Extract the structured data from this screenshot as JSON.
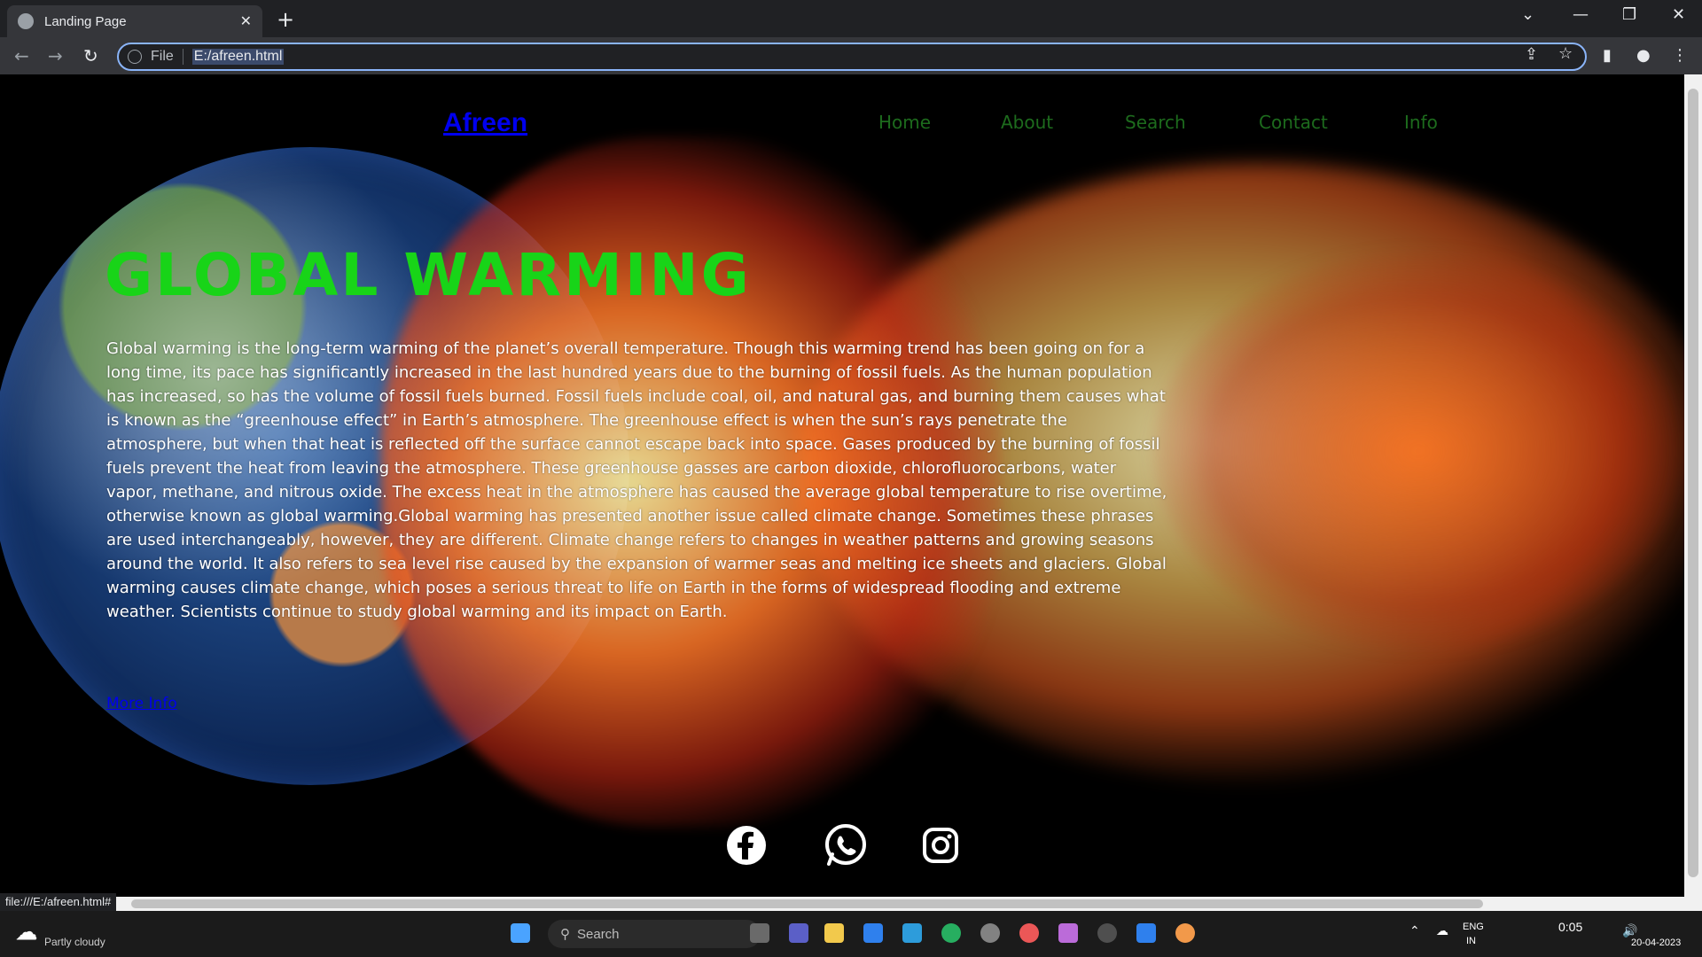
{
  "browser": {
    "tab_title": "Landing Page",
    "address_scheme": "File",
    "address_url": "E:/afreen.html",
    "status_url": "file:///E:/afreen.html#"
  },
  "site": {
    "brand": "Afreen",
    "nav": [
      "Home",
      "About",
      "Search",
      "Contact",
      "Info"
    ],
    "hero_title": "GLOBAL WARMING",
    "hero_text": "Global warming is the long-term warming of the planet’s overall temperature. Though this warming trend has been going on for a long time, its pace has significantly increased in the last hundred years due to the burning of fossil fuels. As the human population has increased, so has the volume of fossil fuels burned. Fossil fuels include coal, oil, and natural gas, and burning them causes what is known as the “greenhouse effect” in Earth’s atmosphere. The greenhouse effect is when the sun’s rays penetrate the atmosphere, but when that heat is reflected off the surface cannot escape back into space. Gases produced by the burning of fossil fuels prevent the heat from leaving the atmosphere. These greenhouse gasses are carbon dioxide, chlorofluorocarbons, water vapor, methane, and nitrous oxide. The excess heat in the atmosphere has caused the average global temperature to rise overtime, otherwise known as global warming.Global warming has presented another issue called climate change. Sometimes these phrases are used interchangeably, however, they are different. Climate change refers to changes in weather patterns and growing seasons around the world. It also refers to sea level rise caused by the expansion of warmer seas and melting ice sheets and glaciers. Global warming causes climate change, which poses a serious threat to life on Earth in the forms of widespread flooding and extreme weather. Scientists continue to study global warming and its impact on Earth.",
    "more_info": "More Info",
    "social_icons": [
      "facebook-icon",
      "whatsapp-icon",
      "instagram-icon"
    ]
  },
  "taskbar": {
    "weather": "Partly cloudy",
    "search_placeholder": "Search",
    "lang": "ENG",
    "region": "IN",
    "time": "0:05",
    "date": "20-04-2023"
  },
  "colors": {
    "brand_link": "#0000ee",
    "nav_text": "#1d6b1d",
    "hero_title": "#18d418"
  }
}
